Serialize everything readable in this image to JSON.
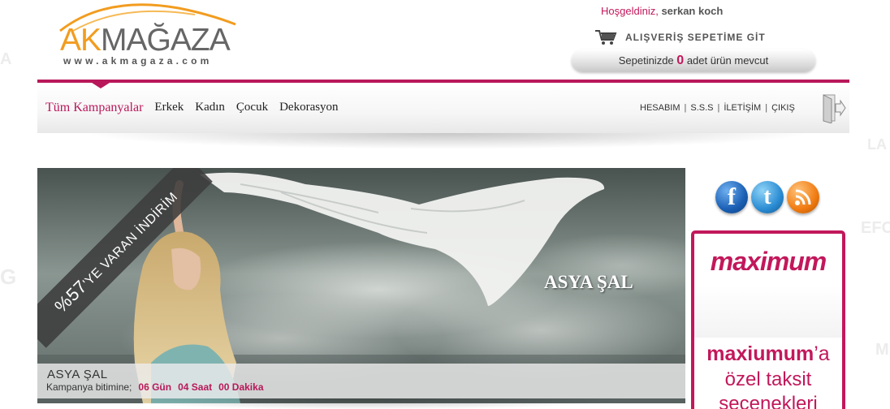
{
  "header": {
    "logo_ak": "AK",
    "logo_rest": "MAĞAZA",
    "logo_url": "www.akmagaza.com",
    "welcome_greeting": "Hoşgeldiniz,",
    "welcome_user": "serkan koch",
    "cart_link_label": "ALIŞVERİŞ SEPETİME GİT",
    "cart_status_prefix": "Sepetinizde",
    "cart_count": "0",
    "cart_status_suffix": "adet ürün mevcut"
  },
  "nav": {
    "items": [
      {
        "label": "Tüm Kampanyalar"
      },
      {
        "label": "Erkek"
      },
      {
        "label": "Kadın"
      },
      {
        "label": "Çocuk"
      },
      {
        "label": "Dekorasyon"
      }
    ],
    "util": [
      {
        "label": "HESABIM"
      },
      {
        "label": "S.S.S"
      },
      {
        "label": "İLETİŞİM"
      },
      {
        "label": "ÇIKIŞ"
      }
    ],
    "util_separator": "|"
  },
  "hero": {
    "ribbon_percent": "%57",
    "ribbon_text": "'YE VARAN İNDİRİM",
    "title": "ASYA ŞAL",
    "caption_name": "ASYA ŞAL",
    "timer_label": "Kampanya bitimine;",
    "timer_days": "06 Gün",
    "timer_hours": "04 Saat",
    "timer_minutes": "00 Dakika"
  },
  "social": {
    "facebook_glyph": "f",
    "twitter_glyph": "t"
  },
  "ad": {
    "logo": "maximum",
    "line1_bold": "maxiumum",
    "line1_suffix": "’a",
    "line2": "özel taksit",
    "line3": "seçenekleri"
  },
  "colors": {
    "brand_pink": "#b8185a",
    "logo_orange": "#f29c1f"
  }
}
